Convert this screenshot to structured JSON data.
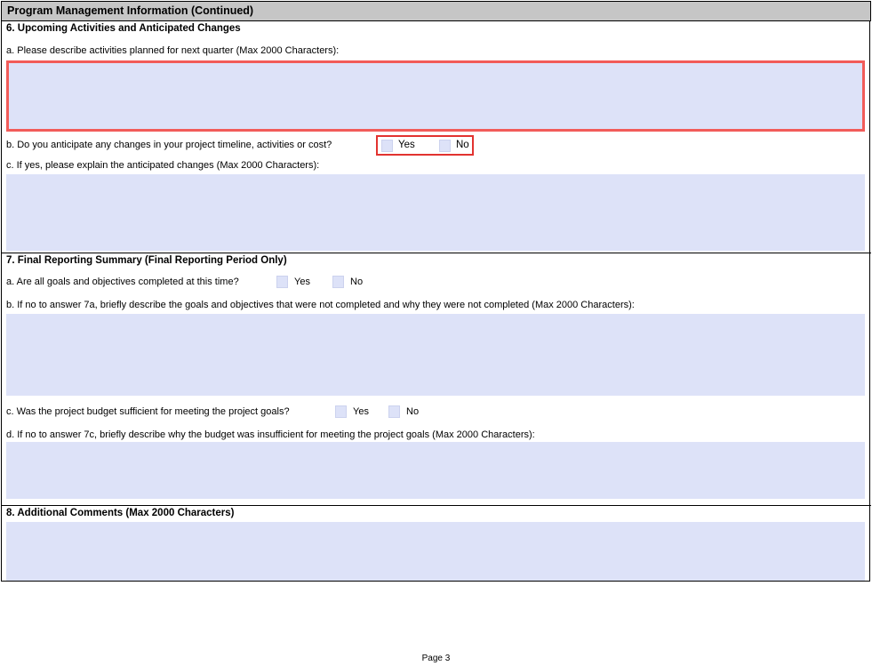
{
  "header": {
    "title": "Program Management Information (Continued)"
  },
  "section6": {
    "heading": "6. Upcoming Activities and Anticipated Changes",
    "q_a": {
      "label": "a. Please describe activities planned for next quarter (Max 2000 Characters):",
      "value": "",
      "required_highlight": true
    },
    "q_b": {
      "label": "b. Do you anticipate any changes in your project timeline, activities or cost?",
      "yes_label": "Yes",
      "no_label": "No",
      "yes_checked": false,
      "no_checked": false,
      "required_highlight": true
    },
    "q_c": {
      "label": "c. If yes, please explain the anticipated changes (Max 2000 Characters):",
      "value": ""
    }
  },
  "section7": {
    "heading": "7. Final Reporting Summary (Final Reporting Period Only)",
    "q_a": {
      "label": "a. Are all goals and objectives completed at this time?",
      "yes_label": "Yes",
      "no_label": "No",
      "yes_checked": false,
      "no_checked": false
    },
    "q_b": {
      "label": "b. If no to answer 7a, briefly describe the goals and objectives that were not completed and why they were not completed (Max 2000 Characters):",
      "value": ""
    },
    "q_c": {
      "label": "c. Was the project budget sufficient for meeting the project goals?",
      "yes_label": "Yes",
      "no_label": "No",
      "yes_checked": false,
      "no_checked": false
    },
    "q_d": {
      "label": "d. If no to answer 7c, briefly describe why the budget was insufficient for meeting the project goals (Max 2000 Characters):",
      "value": ""
    }
  },
  "section8": {
    "heading": "8. Additional Comments (Max 2000 Characters)",
    "value": ""
  },
  "footer": {
    "page_label": "Page 3"
  },
  "colors": {
    "header_gray": "#c6c6c6",
    "field_blue": "#dde2f8",
    "required_red_border": "#f25b59",
    "required_red_box": "#e23330",
    "form_border": "#000000"
  }
}
